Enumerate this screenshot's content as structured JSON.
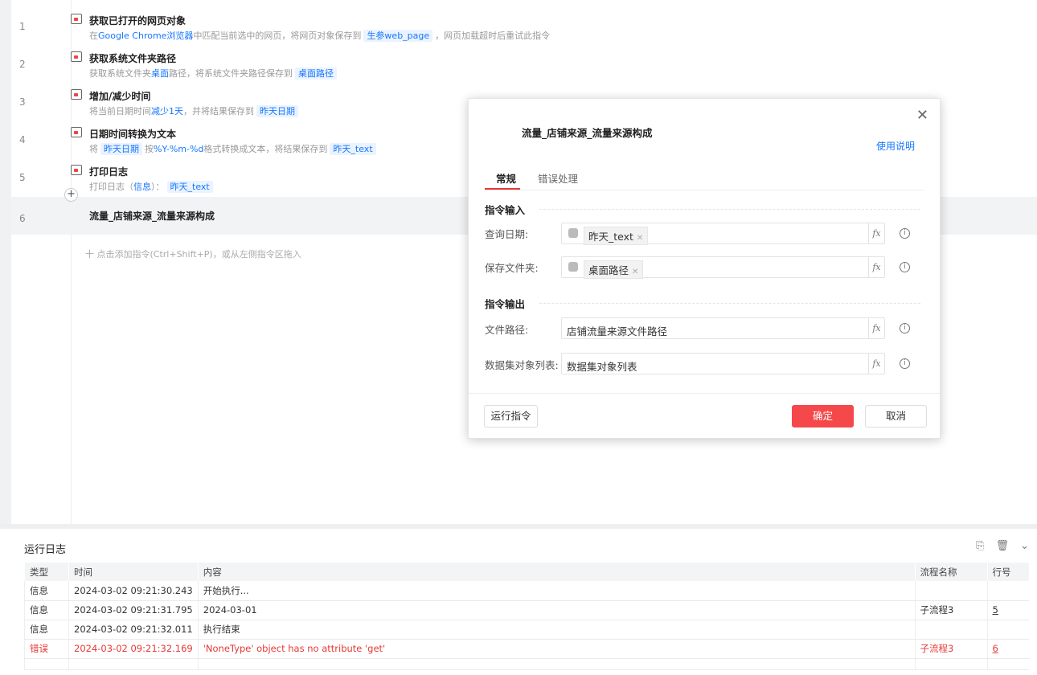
{
  "steps": [
    {
      "num": "1",
      "title": "获取已打开的网页对象",
      "icon": "browser-icon",
      "desc": [
        {
          "t": "在",
          "k": "plain"
        },
        {
          "t": "Google Chrome浏览器",
          "k": "hl"
        },
        {
          "t": "中匹配当前选中的网页，将网页对象保存到",
          "k": "plain"
        },
        {
          "t": "生参web_page",
          "k": "var"
        },
        {
          "t": "，网页加载超时后重试此指令",
          "k": "plain"
        }
      ]
    },
    {
      "num": "2",
      "title": "获取系统文件夹路径",
      "icon": "folder-icon",
      "desc": [
        {
          "t": "获取系统文件夹",
          "k": "plain"
        },
        {
          "t": "桌面",
          "k": "hl"
        },
        {
          "t": "路径，将系统文件夹路径保存到",
          "k": "plain"
        },
        {
          "t": "桌面路径",
          "k": "var"
        }
      ]
    },
    {
      "num": "3",
      "title": "增加/减少时间",
      "icon": "calendar-icon",
      "desc": [
        {
          "t": "将当前日期时间",
          "k": "plain"
        },
        {
          "t": "减少1天",
          "k": "hl"
        },
        {
          "t": "，并将结果保存到",
          "k": "plain"
        },
        {
          "t": "昨天日期",
          "k": "var"
        }
      ]
    },
    {
      "num": "4",
      "title": "日期时间转换为文本",
      "icon": "calendar-text-icon",
      "desc": [
        {
          "t": "将",
          "k": "plain"
        },
        {
          "t": "昨天日期",
          "k": "var"
        },
        {
          "t": "按",
          "k": "plain"
        },
        {
          "t": "%Y-%m-%d",
          "k": "hl"
        },
        {
          "t": "格式转换成文本，将结果保存到",
          "k": "plain"
        },
        {
          "t": "昨天_text",
          "k": "var"
        }
      ]
    },
    {
      "num": "5",
      "title": "打印日志",
      "icon": "print-log-icon",
      "desc": [
        {
          "t": "打印日志（",
          "k": "plain"
        },
        {
          "t": "信息",
          "k": "hl"
        },
        {
          "t": "）：",
          "k": "plain"
        },
        {
          "t": "昨天_text",
          "k": "var"
        }
      ]
    },
    {
      "num": "6",
      "title": "流量_店铺来源_流量来源构成",
      "icon": "",
      "desc": []
    }
  ],
  "add_hint": "十 点击添加指令(Ctrl+Shift+P)，或从左侧指令区拖入",
  "dialog": {
    "title": "流量_店铺来源_流量来源构成",
    "help": "使用说明",
    "close": "✕",
    "tabs": [
      "常规",
      "错误处理"
    ],
    "input_section": "指令输入",
    "output_section": "指令输出",
    "inputs": [
      {
        "label": "查询日期:",
        "tag": "昨天_text"
      },
      {
        "label": "保存文件夹:",
        "tag": "桌面路径"
      }
    ],
    "outputs": [
      {
        "label": "文件路径:",
        "value": "店铺流量来源文件路径"
      },
      {
        "label": "数据集对象列表:",
        "value": "数据集对象列表"
      }
    ],
    "fx": "fx",
    "run": "运行指令",
    "ok": "确定",
    "cancel": "取消"
  },
  "log": {
    "title": "运行日志",
    "columns": [
      "类型",
      "时间",
      "内容",
      "流程名称",
      "行号"
    ],
    "rows": [
      {
        "type": "信息",
        "time": "2024-03-02 09:21:30.243",
        "content": "开始执行...",
        "flow": "",
        "line": "",
        "error": false
      },
      {
        "type": "信息",
        "time": "2024-03-02 09:21:31.795",
        "content": "2024-03-01",
        "flow": "子流程3",
        "line": "5",
        "error": false
      },
      {
        "type": "信息",
        "time": "2024-03-02 09:21:32.011",
        "content": "执行结束",
        "flow": "",
        "line": "",
        "error": false
      },
      {
        "type": "错误",
        "time": "2024-03-02 09:21:32.169",
        "content": " 'NoneType' object has no attribute 'get'",
        "flow": "子流程3",
        "line": "6",
        "error": true
      }
    ]
  },
  "colors": {
    "accent": "#f5484a",
    "link": "#1677ff",
    "error": "#e53935"
  }
}
